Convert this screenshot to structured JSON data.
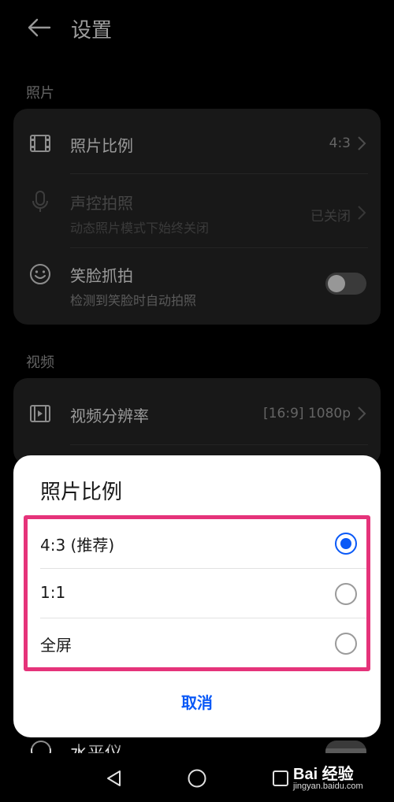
{
  "header": {
    "title": "设置"
  },
  "photo_section": {
    "label": "照片",
    "items": [
      {
        "title": "照片比例",
        "value": "4:3"
      },
      {
        "title": "声控拍照",
        "subtitle": "动态照片模式下始终关闭",
        "value": "已关闭"
      },
      {
        "title": "笑脸抓拍",
        "subtitle": "检测到笑脸时自动拍照",
        "toggle_on": false
      }
    ]
  },
  "video_section": {
    "label": "视频",
    "items": [
      {
        "title": "视频分辨率",
        "value": "[16:9] 1080p"
      }
    ]
  },
  "dialog": {
    "title": "照片比例",
    "options": [
      {
        "label": "4:3 (推荐)",
        "selected": true
      },
      {
        "label": "1:1",
        "selected": false
      },
      {
        "label": "全屏",
        "selected": false
      }
    ],
    "cancel_label": "取消"
  },
  "peek_item": {
    "title": "水平仪"
  },
  "watermark": {
    "main": "Bai 经验",
    "sub": "jingyan.baidu.com"
  },
  "colors": {
    "accent": "#0a59f7",
    "highlight": "#e5337a",
    "card": "#262626"
  }
}
